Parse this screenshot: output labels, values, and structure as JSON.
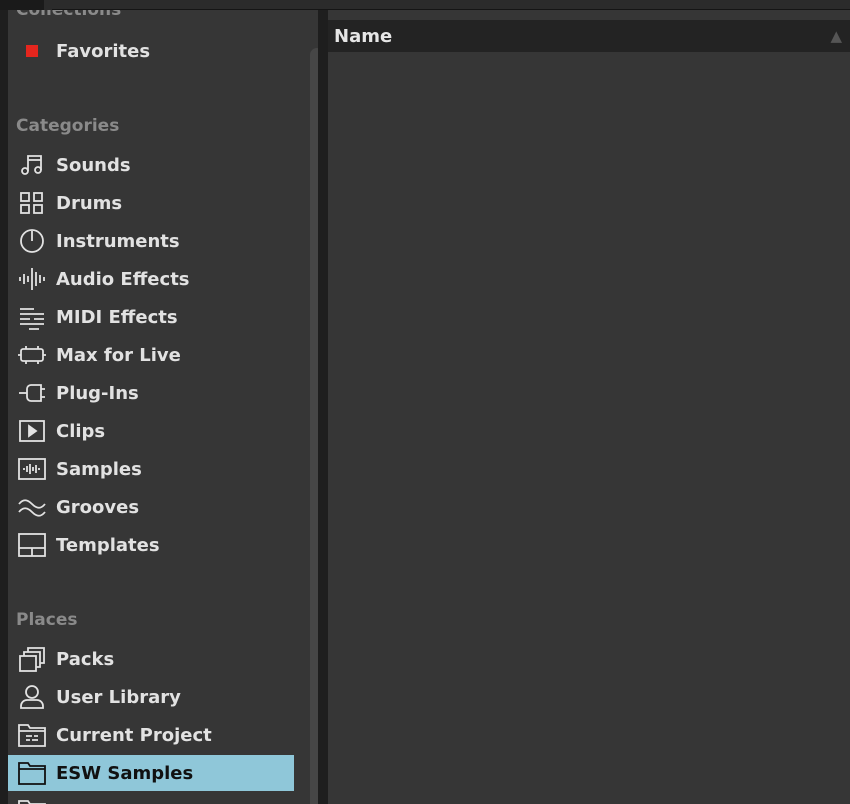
{
  "collections": {
    "header": "Collections",
    "favorites": {
      "label": "Favorites",
      "color": "#e5261e"
    }
  },
  "categories": {
    "header": "Categories",
    "items": [
      {
        "label": "Sounds",
        "icon": "music-note-icon"
      },
      {
        "label": "Drums",
        "icon": "grid-icon"
      },
      {
        "label": "Instruments",
        "icon": "power-icon"
      },
      {
        "label": "Audio Effects",
        "icon": "waveform-icon"
      },
      {
        "label": "MIDI Effects",
        "icon": "midi-bars-icon"
      },
      {
        "label": "Max for Live",
        "icon": "max-patch-icon"
      },
      {
        "label": "Plug-Ins",
        "icon": "plug-icon"
      },
      {
        "label": "Clips",
        "icon": "play-box-icon"
      },
      {
        "label": "Samples",
        "icon": "sample-wave-box-icon"
      },
      {
        "label": "Grooves",
        "icon": "wave-lines-icon"
      },
      {
        "label": "Templates",
        "icon": "template-icon"
      }
    ]
  },
  "places": {
    "header": "Places",
    "items": [
      {
        "label": "Packs",
        "icon": "packs-icon"
      },
      {
        "label": "User Library",
        "icon": "user-icon"
      },
      {
        "label": "Current Project",
        "icon": "project-folder-icon"
      },
      {
        "label": "ESW Samples",
        "icon": "folder-icon",
        "selected": true
      }
    ]
  },
  "browser": {
    "column_name": "Name",
    "sort_indicator": "▲"
  },
  "colors": {
    "panel_bg": "#363636",
    "selected_bg": "#8fc7d9",
    "header_text": "#8a8a8a"
  }
}
